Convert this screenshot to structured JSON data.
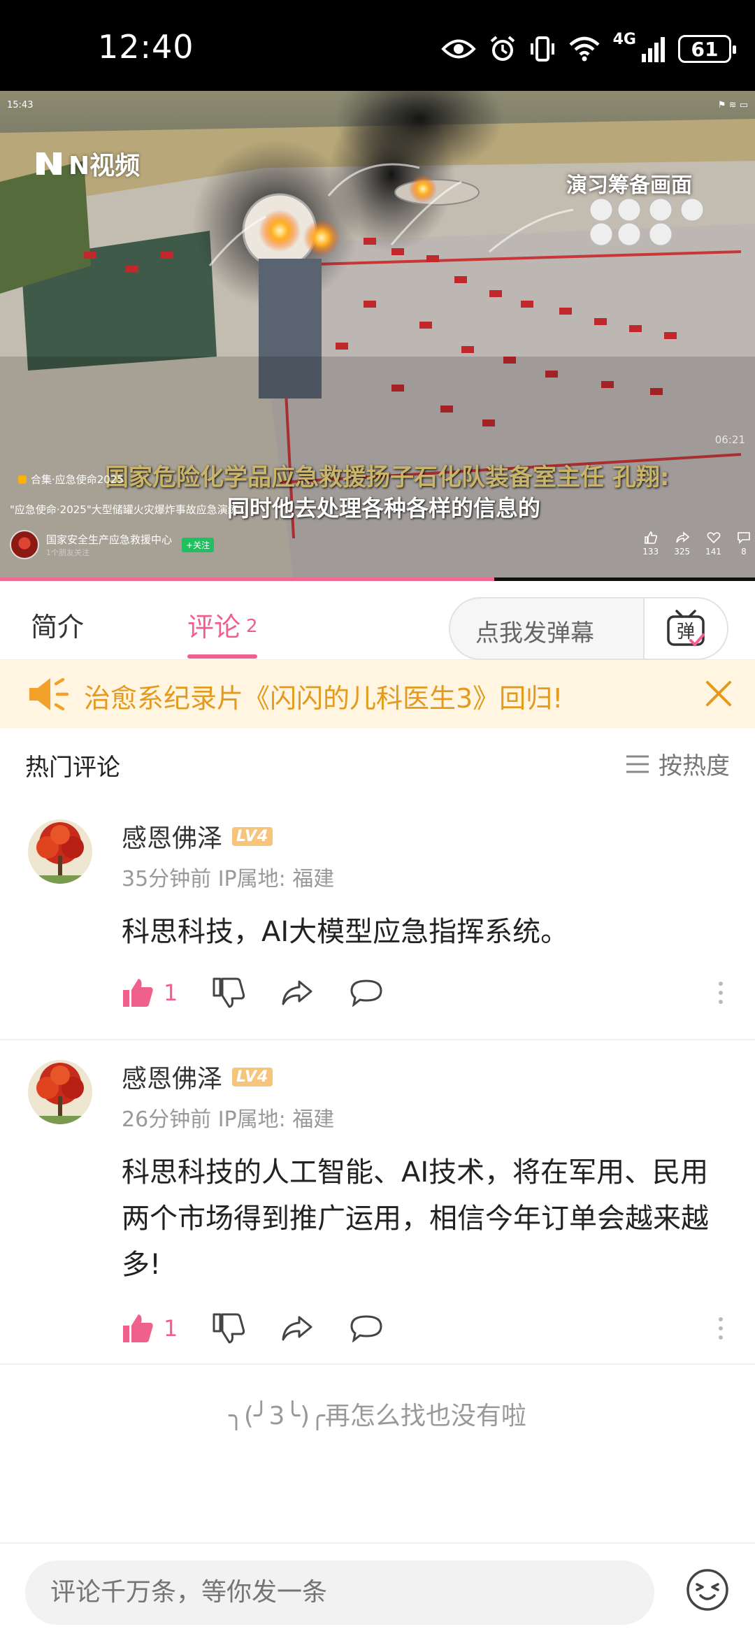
{
  "status_bar": {
    "time": "12:40",
    "network": "4G",
    "battery": "61"
  },
  "video": {
    "inner_status_time": "15:43",
    "logo_text": "N视频",
    "corner_label": "演习筹备画面",
    "timestamp": "06:21",
    "subtitle_line1": "国家危险化学品应急救援扬子石化队装备室主任 孔翔:",
    "subtitle_line2": "同时他去处理各种各样的信息的",
    "collection": "合集·应急使命2025",
    "description": "\"应急使命·2025\"大型储罐火灾爆炸事故应急演练...",
    "channel_name": "国家安全生产应急救援中心",
    "channel_sub": "1个朋友关注",
    "follow_label": "+关注",
    "stats": {
      "likes": "133",
      "shares": "325",
      "favorites": "141",
      "comments": "8"
    },
    "progress": 0.655
  },
  "tabs": {
    "intro": "简介",
    "comments": "评论",
    "comments_count": "2",
    "danmaku_placeholder": "点我发弹幕",
    "danmaku_icon_label": "弹"
  },
  "banner": {
    "text": "治愈系纪录片《闪闪的儿科医生3》回归!"
  },
  "hot_comments": {
    "title": "热门评论",
    "sort_label": "按热度"
  },
  "comments": [
    {
      "user": "感恩佛泽",
      "level": "LV4",
      "meta": "35分钟前 IP属地: 福建",
      "text": "科思科技，AI大模型应急指挥系统。",
      "likes": "1"
    },
    {
      "user": "感恩佛泽",
      "level": "LV4",
      "meta": "26分钟前 IP属地: 福建",
      "text": "科思科技的人工智能、AI技术，将在军用、民用两个市场得到推广运用，相信今年订单会越来越多!",
      "likes": "1"
    }
  ],
  "end_text": "╮(╯3╰)╭再怎么找也没有啦",
  "bottom": {
    "placeholder": "评论千万条，等你发一条"
  },
  "colors": {
    "accent": "#f0608c",
    "banner_bg": "#fff5e0",
    "banner_text": "#e39a1f"
  }
}
